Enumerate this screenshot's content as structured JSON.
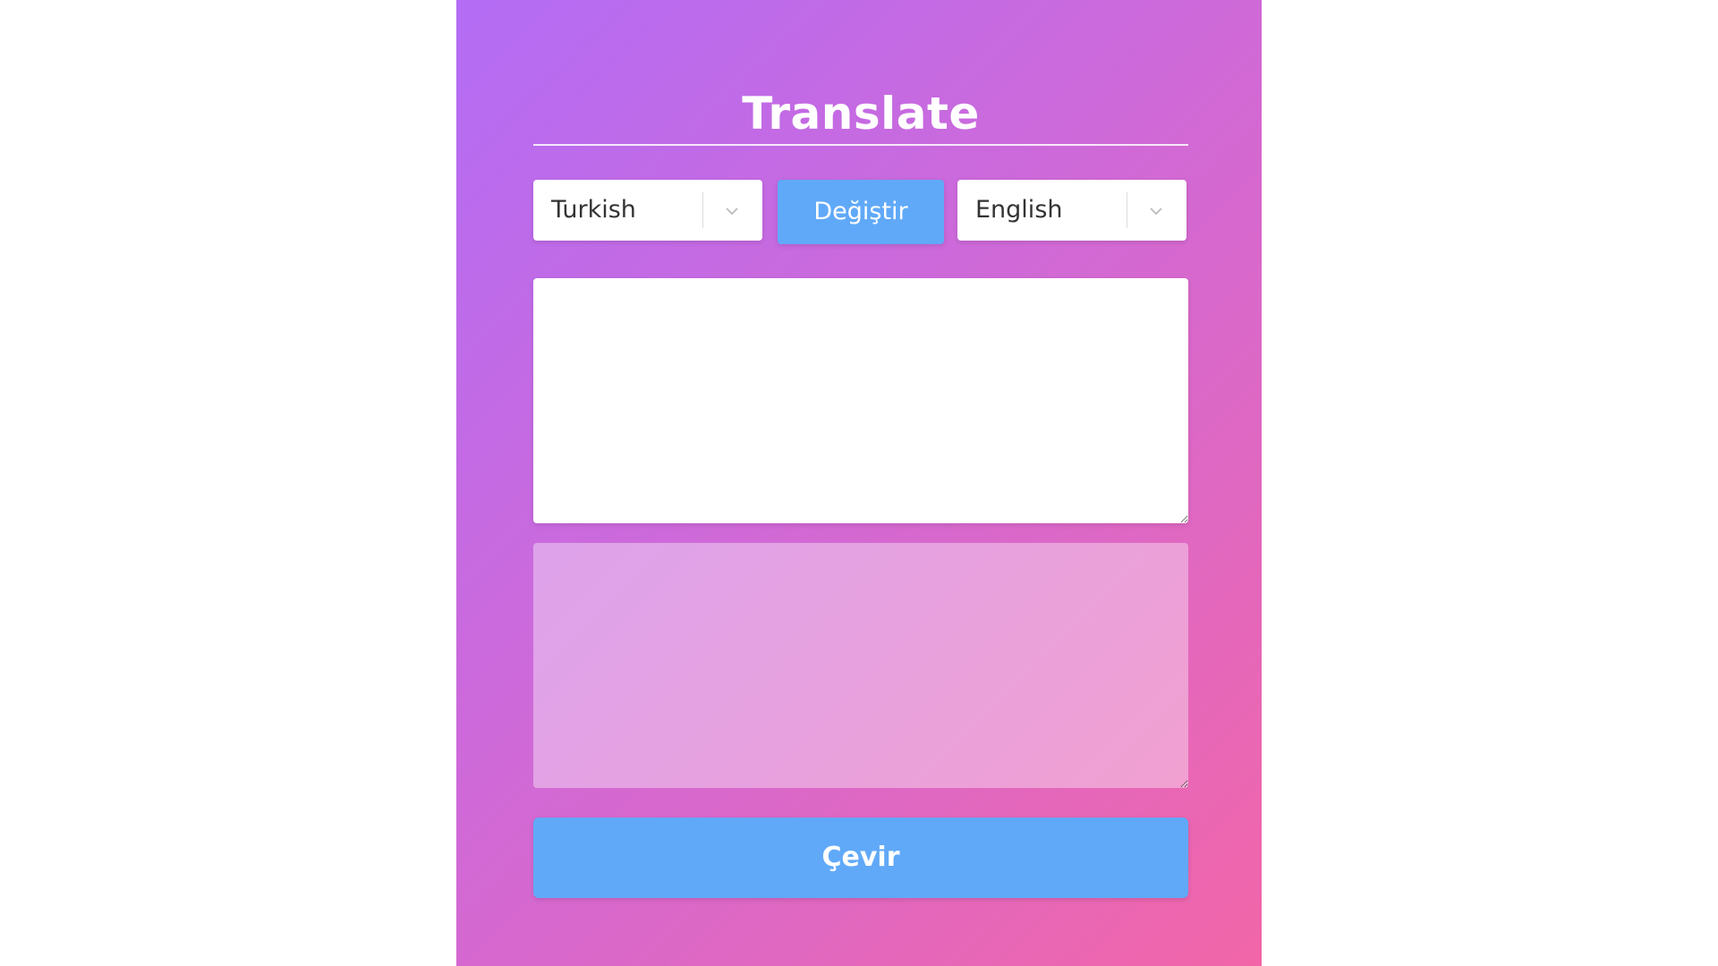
{
  "app": {
    "title": "Translate"
  },
  "languages": {
    "source": "Turkish",
    "target": "English",
    "swap_label": "Değiştir"
  },
  "input": {
    "value": "",
    "placeholder": ""
  },
  "output": {
    "value": ""
  },
  "actions": {
    "translate_label": "Çevir"
  },
  "icons": {
    "dropdown": "chevron-down-icon"
  },
  "colors": {
    "gradient_start": "#b36cf5",
    "gradient_end": "#f266a8",
    "button": "#60a9f8"
  }
}
